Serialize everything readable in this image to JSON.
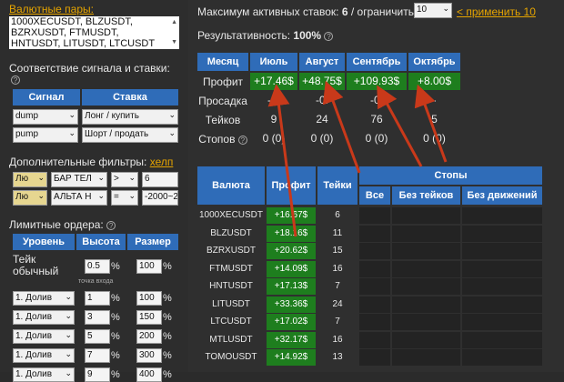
{
  "left": {
    "pairs_label": "Валютные пары:",
    "pairs_text": "1000XECUSDT, BLZUSDT, BZRXUSDT, FTMUSDT, HNTUSDT, LITUSDT, LTCUSDT",
    "signal_section_title": "Соответствие сигнала и ставки:",
    "signal_header": "Сигнал",
    "bet_header": "Ставка",
    "signal_rows": [
      {
        "signal": "dump",
        "bet": "Лонг / купить"
      },
      {
        "signal": "pump",
        "bet": "Шорт / продать"
      }
    ],
    "filters_title": "Дополнительные фильтры:",
    "filters_help": "хелп",
    "filter_rows": [
      {
        "a": "Лю",
        "b": "БАР ТЕЛ",
        "op": ">",
        "val": "6"
      },
      {
        "a": "Лю",
        "b": "АЛЬТА Н",
        "op": "=",
        "val": "-2000~2"
      }
    ],
    "limit_title": "Лимитные ордера:",
    "limit_headers": [
      "Уровень",
      "Высота",
      "Размер"
    ],
    "take_label_1": "Тейк",
    "take_label_2": "обычный",
    "take_height": "0.5",
    "take_size": "100",
    "entry_point_label": "точка входа",
    "limit_rows": [
      {
        "level": "1. Долив",
        "height": "1",
        "size": "100"
      },
      {
        "level": "1. Долив",
        "height": "3",
        "size": "150"
      },
      {
        "level": "1. Долив",
        "height": "5",
        "size": "200"
      },
      {
        "level": "1. Долив",
        "height": "7",
        "size": "300"
      },
      {
        "level": "1. Долив",
        "height": "9",
        "size": "400"
      }
    ],
    "pct": "%"
  },
  "top": {
    "max_label": "Максимум активных ставок:",
    "max_value": "6",
    "limit_label": "/ ограничить",
    "limit_select": "10",
    "apply_label": "< применить 10",
    "perf_label": "Результативность:",
    "perf_value": "100%"
  },
  "monthly": {
    "headers": [
      "Месяц",
      "Июль",
      "Август",
      "Сентябрь",
      "Октябрь"
    ],
    "rows": [
      {
        "label": "Профит",
        "values": [
          "+17.46$",
          "+48.75$",
          "+109.93$",
          "+8.00$"
        ]
      },
      {
        "label": "Просадка",
        "values": [
          "-0.",
          "-0.",
          "-0.",
          "-"
        ]
      },
      {
        "label": "Тейков",
        "values": [
          "9",
          "24",
          "76",
          "5"
        ]
      },
      {
        "label": "Стопов",
        "values": [
          "0 (0)",
          "0 (0)",
          "0 (0)",
          "0 (0)"
        ]
      }
    ]
  },
  "currency": {
    "headers": {
      "currency": "Валюта",
      "profit": "Профит",
      "takes": "Тейки",
      "stops": "Стопы",
      "all": "Все",
      "no_takes": "Без тейков",
      "no_moves": "Без движений"
    },
    "rows": [
      {
        "pair": "1000XECUSDT",
        "profit": "+16.67$",
        "takes": "6"
      },
      {
        "pair": "BLZUSDT",
        "profit": "+18.16$",
        "takes": "11"
      },
      {
        "pair": "BZRXUSDT",
        "profit": "+20.62$",
        "takes": "15"
      },
      {
        "pair": "FTMUSDT",
        "profit": "+14.09$",
        "takes": "16"
      },
      {
        "pair": "HNTUSDT",
        "profit": "+17.13$",
        "takes": "7"
      },
      {
        "pair": "LITUSDT",
        "profit": "+33.36$",
        "takes": "24"
      },
      {
        "pair": "LTCUSDT",
        "profit": "+17.02$",
        "takes": "7"
      },
      {
        "pair": "MTLUSDT",
        "profit": "+32.17$",
        "takes": "16"
      },
      {
        "pair": "TOMOUSDT",
        "profit": "+14.92$",
        "takes": "13"
      }
    ]
  },
  "colors": {
    "accent_blue": "#2f6cb8",
    "profit_green": "#1e7e1e",
    "arrow_red": "#c9391a",
    "link_orange": "#e5a400"
  }
}
